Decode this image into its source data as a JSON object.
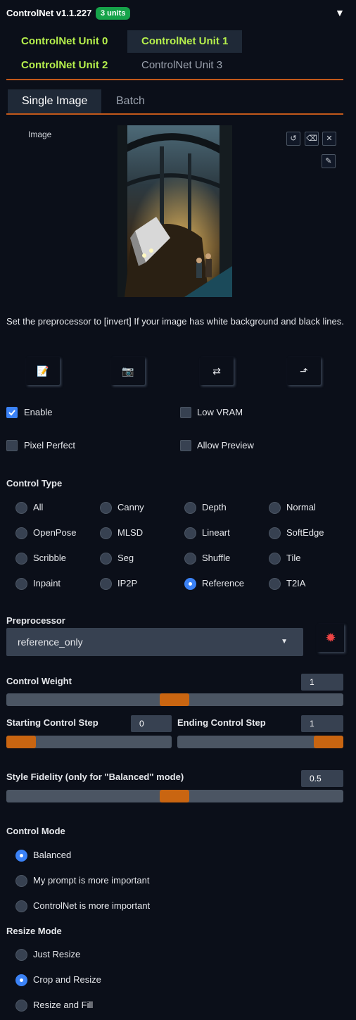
{
  "header": {
    "title": "ControlNet v1.1.227",
    "badge": "3 units",
    "collapse_icon": "▼"
  },
  "unit_tabs": [
    {
      "label": "ControlNet Unit 0",
      "state": "enabled"
    },
    {
      "label": "ControlNet Unit 1",
      "state": "selected"
    },
    {
      "label": "ControlNet Unit 2",
      "state": "enabled"
    },
    {
      "label": "ControlNet Unit 3",
      "state": "disabled"
    }
  ],
  "image_tabs": [
    {
      "label": "Single Image",
      "selected": true
    },
    {
      "label": "Batch",
      "selected": false
    }
  ],
  "image_panel": {
    "label": "Image",
    "tool_icons": [
      "undo-icon",
      "eraser-icon",
      "close-icon",
      "brush-icon"
    ]
  },
  "hint_text": "Set the preprocessor to [invert] If your image has white background and black lines.",
  "action_icons": [
    "new-canvas-icon",
    "camera-icon",
    "swap-icon",
    "send-dimensions-icon"
  ],
  "checkboxes": [
    {
      "label": "Enable",
      "checked": true
    },
    {
      "label": "Low VRAM",
      "checked": false
    },
    {
      "label": "Pixel Perfect",
      "checked": false
    },
    {
      "label": "Allow Preview",
      "checked": false
    }
  ],
  "control_type": {
    "label": "Control Type",
    "options": [
      "All",
      "Canny",
      "Depth",
      "Normal",
      "OpenPose",
      "MLSD",
      "Lineart",
      "SoftEdge",
      "Scribble",
      "Seg",
      "Shuffle",
      "Tile",
      "Inpaint",
      "IP2P",
      "Reference",
      "T2IA"
    ],
    "selected": "Reference"
  },
  "preprocessor": {
    "label": "Preprocessor",
    "value": "reference_only",
    "run_icon": "burst-icon"
  },
  "sliders": {
    "control_weight": {
      "label": "Control Weight",
      "value": "1",
      "fraction": 0.5
    },
    "starting_step": {
      "label": "Starting Control Step",
      "value": "0",
      "fraction": 0.0
    },
    "ending_step": {
      "label": "Ending Control Step",
      "value": "1",
      "fraction": 1.0
    },
    "style_fidelity": {
      "label": "Style Fidelity (only for \"Balanced\" mode)",
      "value": "0.5",
      "fraction": 0.5
    }
  },
  "control_mode": {
    "label": "Control Mode",
    "options": [
      "Balanced",
      "My prompt is more important",
      "ControlNet is more important"
    ],
    "selected": "Balanced"
  },
  "resize_mode": {
    "label": "Resize Mode",
    "options": [
      "Just Resize",
      "Crop and Resize",
      "Resize and Fill"
    ],
    "selected": "Crop and Resize"
  },
  "colors": {
    "accent_orange": "#c96511",
    "enabled_green": "#b6f04c",
    "badge_green": "#16a34a",
    "radio_blue": "#3b82f6"
  }
}
